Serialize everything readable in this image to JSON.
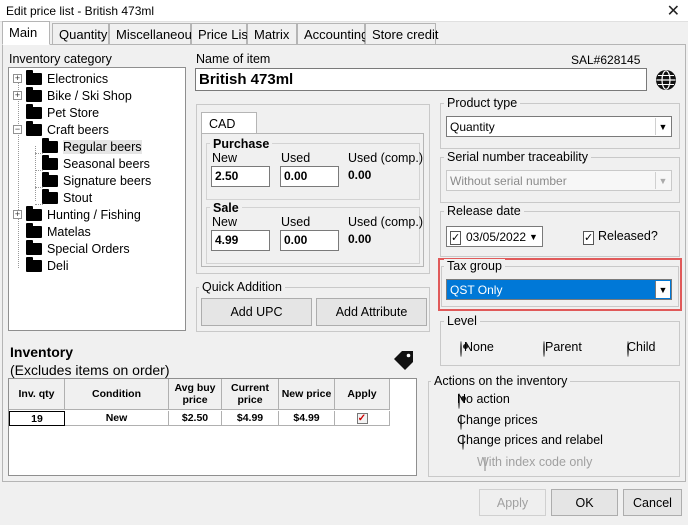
{
  "window": {
    "title": "Edit price list - British 473ml",
    "close_glyph": "✕"
  },
  "tabs": [
    "Main",
    "Quantity",
    "Miscellaneous",
    "Price List",
    "Matrix",
    "Accounting",
    "Store credit"
  ],
  "category": {
    "label": "Inventory category",
    "items": [
      "Electronics",
      "Bike / Ski Shop",
      "Pet Store",
      "Craft beers",
      "Regular beers",
      "Seasonal beers",
      "Signature beers",
      "Stout",
      "Hunting / Fishing",
      "Matelas",
      "Special Orders",
      "Deli"
    ],
    "expanders": [
      "+",
      "+",
      "−",
      "+"
    ]
  },
  "item": {
    "name_label": "Name of item",
    "sku": "SAL#628145",
    "name_value": "British 473ml",
    "globe_icon": "globe-icon"
  },
  "pricing": {
    "currency_tab": "CAD",
    "purchase": {
      "title": "Purchase",
      "new_label": "New",
      "used_label": "Used",
      "used_comp_label": "Used (comp.)",
      "new_value": "2.50",
      "used_value": "0.00",
      "used_comp_value": "0.00"
    },
    "sale": {
      "title": "Sale",
      "new_label": "New",
      "used_label": "Used",
      "used_comp_label": "Used (comp.)",
      "new_value": "4.99",
      "used_value": "0.00",
      "used_comp_value": "0.00"
    }
  },
  "quick_addition": {
    "title": "Quick Addition",
    "add_upc": "Add UPC",
    "add_attribute": "Add Attribute"
  },
  "product_type": {
    "label": "Product type",
    "value": "Quantity"
  },
  "serial": {
    "label": "Serial number traceability",
    "value": "Without serial number"
  },
  "release": {
    "label": "Release date",
    "date": "03/05/2022",
    "date_checked": "✓",
    "released_label": "Released?",
    "released_checked": "✓"
  },
  "tax": {
    "label": "Tax group",
    "value": "QST Only",
    "highlight_color": "#e05a5a"
  },
  "level": {
    "label": "Level",
    "options": [
      "None",
      "Parent",
      "Child"
    ],
    "selected": "None"
  },
  "inventory": {
    "title": "Inventory",
    "subtitle": "(Excludes items on order)",
    "tag_icon": "tag-icon",
    "columns": [
      "Inv. qty",
      "Condition",
      "Avg buy price",
      "Current price",
      "New price",
      "Apply"
    ],
    "rows": [
      {
        "qty": "19",
        "condition": "New",
        "avg_buy": "$2.50",
        "current": "$4.99",
        "new_price": "$4.99",
        "apply": "✓"
      }
    ]
  },
  "actions": {
    "title": "Actions on the inventory",
    "options": [
      "No action",
      "Change prices",
      "Change prices and relabel"
    ],
    "selected": "No action",
    "index_code_label": "With index code only"
  },
  "footer": {
    "apply": "Apply",
    "ok": "OK",
    "cancel": "Cancel"
  },
  "colors": {
    "accent": "#0078d7",
    "window_bg": "#f0f0f0"
  }
}
